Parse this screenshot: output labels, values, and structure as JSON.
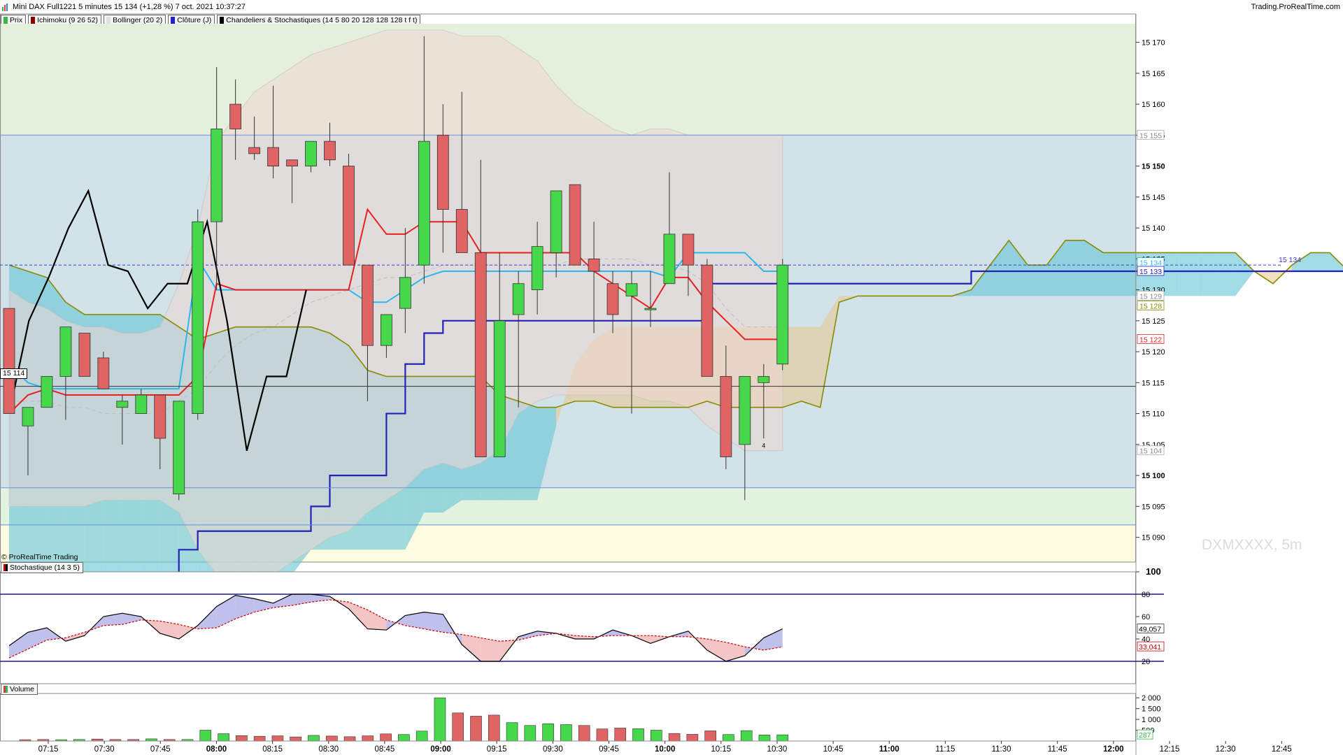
{
  "header": {
    "title": "Mini DAX Full1221 5 minutes 15 134 (+1,28 %) 7 oct. 2021 10:37:27",
    "brand": "Trading.ProRealTime.com"
  },
  "legend": [
    {
      "label": "Prix",
      "color": "#3cb44b"
    },
    {
      "label": "Ichimoku (9 26 52)",
      "color": "#8b0000"
    },
    {
      "label": "Bollinger (20 2)",
      "color": "#e0e0e0"
    },
    {
      "label": "Clôture (J)",
      "color": "#2222cc"
    },
    {
      "label": "Chandeliers & Stochastiques (14 5 80 20 128 128 128 t f t)",
      "color": "#000000"
    }
  ],
  "copyright": "© ProRealTime Trading",
  "watermark": "DXMXXXX, 5m",
  "current_price_left": "15 114",
  "candle_marker": "4",
  "price_labels": [
    {
      "text": "15 134",
      "price": 15134,
      "style": "last"
    },
    {
      "text": "15 134",
      "price": 15134.4,
      "style": "cyan"
    },
    {
      "text": "15 133",
      "price": 15133,
      "style": "navy"
    },
    {
      "text": "15 129",
      "price": 15129,
      "style": "gray"
    },
    {
      "text": "15 128",
      "price": 15127.4,
      "style": "olive"
    },
    {
      "text": "15 122",
      "price": 15122,
      "style": "red"
    },
    {
      "text": "15 155",
      "price": 15155,
      "style": "gray"
    },
    {
      "text": "15 104",
      "price": 15104,
      "style": "gray"
    }
  ],
  "dashed_label": "15 134",
  "stoch_legend": "Stochastique (14 3 5)",
  "stoch_labels": [
    {
      "text": "49,057",
      "value": 49.057,
      "style": "black"
    },
    {
      "text": "33,041",
      "value": 33.041,
      "style": "red"
    }
  ],
  "volume_legend": "Volume",
  "volume_labels": [
    {
      "text": "287",
      "value": 287,
      "style": "green"
    }
  ],
  "chart_data": [
    {
      "type": "candlestick",
      "pane": "price",
      "ylim": [
        15086,
        15173
      ],
      "yticks": [
        15090,
        15095,
        15100,
        15105,
        15110,
        15115,
        15120,
        15125,
        15130,
        15135,
        15140,
        15145,
        15150,
        15155,
        15160,
        15165,
        15170
      ],
      "ytick_labels": [
        "15 090",
        "15 095",
        "15 100",
        "15 105",
        "15 110",
        "15 115",
        "15 120",
        "15 125",
        "15 130",
        "15 135",
        "15 140",
        "15 145",
        "15 150",
        "15 155",
        "15 160",
        "15 165",
        "15 170"
      ],
      "ytick_bold": [
        15100,
        15150
      ],
      "xticks": [
        {
          "label": "07:15",
          "bold": false
        },
        {
          "label": "07:30",
          "bold": false
        },
        {
          "label": "07:45",
          "bold": false
        },
        {
          "label": "08:00",
          "bold": true
        },
        {
          "label": "08:15",
          "bold": false
        },
        {
          "label": "08:30",
          "bold": false
        },
        {
          "label": "08:45",
          "bold": false
        },
        {
          "label": "09:00",
          "bold": true
        },
        {
          "label": "09:15",
          "bold": false
        },
        {
          "label": "09:30",
          "bold": false
        },
        {
          "label": "09:45",
          "bold": false
        },
        {
          "label": "10:00",
          "bold": true
        },
        {
          "label": "10:15",
          "bold": false
        },
        {
          "label": "10:30",
          "bold": false
        },
        {
          "label": "10:45",
          "bold": false
        },
        {
          "label": "11:00",
          "bold": true
        },
        {
          "label": "11:15",
          "bold": false
        },
        {
          "label": "11:30",
          "bold": false
        },
        {
          "label": "11:45",
          "bold": false
        },
        {
          "label": "12:00",
          "bold": true
        },
        {
          "label": "12:15",
          "bold": false
        },
        {
          "label": "12:30",
          "bold": false
        },
        {
          "label": "12:45",
          "bold": false
        }
      ],
      "candles": [
        {
          "o": 15127,
          "h": 15127,
          "l": 15110,
          "c": 15110
        },
        {
          "o": 15108,
          "h": 15111,
          "l": 15100,
          "c": 15111
        },
        {
          "o": 15111,
          "h": 15116,
          "l": 15111,
          "c": 15116
        },
        {
          "o": 15116,
          "h": 15124,
          "l": 15109,
          "c": 15124
        },
        {
          "o": 15123,
          "h": 15123,
          "l": 15116,
          "c": 15116
        },
        {
          "o": 15119,
          "h": 15120,
          "l": 15114,
          "c": 15114
        },
        {
          "o": 15111,
          "h": 15113,
          "l": 15105,
          "c": 15112
        },
        {
          "o": 15110,
          "h": 15114,
          "l": 15110,
          "c": 15113
        },
        {
          "o": 15113,
          "h": 15113,
          "l": 15101,
          "c": 15106
        },
        {
          "o": 15097,
          "h": 15112,
          "l": 15096,
          "c": 15112
        },
        {
          "o": 15110,
          "h": 15143,
          "l": 15109,
          "c": 15141
        },
        {
          "o": 15141,
          "h": 15166,
          "l": 15130,
          "c": 15156
        },
        {
          "o": 15160,
          "h": 15164,
          "l": 15151,
          "c": 15156
        },
        {
          "o": 15153,
          "h": 15158,
          "l": 15151,
          "c": 15152
        },
        {
          "o": 15153,
          "h": 15163,
          "l": 15148,
          "c": 15150
        },
        {
          "o": 15151,
          "h": 15151,
          "l": 15144,
          "c": 15150
        },
        {
          "o": 15150,
          "h": 15154,
          "l": 15149,
          "c": 15154
        },
        {
          "o": 15154,
          "h": 15157,
          "l": 15150,
          "c": 15151
        },
        {
          "o": 15150,
          "h": 15152,
          "l": 15134,
          "c": 15134
        },
        {
          "o": 15134,
          "h": 15134,
          "l": 15112,
          "c": 15121
        },
        {
          "o": 15121,
          "h": 15126,
          "l": 15119,
          "c": 15126
        },
        {
          "o": 15127,
          "h": 15140,
          "l": 15123,
          "c": 15132
        },
        {
          "o": 15134,
          "h": 15171,
          "l": 15131,
          "c": 15154
        },
        {
          "o": 15155,
          "h": 15160,
          "l": 15136,
          "c": 15143
        },
        {
          "o": 15143,
          "h": 15162,
          "l": 15136,
          "c": 15136
        },
        {
          "o": 15136,
          "h": 15151,
          "l": 15103,
          "c": 15103
        },
        {
          "o": 15103,
          "h": 15136,
          "l": 15103,
          "c": 15125
        },
        {
          "o": 15126,
          "h": 15133,
          "l": 15111,
          "c": 15131
        },
        {
          "o": 15130,
          "h": 15141,
          "l": 15126,
          "c": 15137
        },
        {
          "o": 15136,
          "h": 15146,
          "l": 15132,
          "c": 15146
        },
        {
          "o": 15147,
          "h": 15147,
          "l": 15134,
          "c": 15134
        },
        {
          "o": 15135,
          "h": 15141,
          "l": 15123,
          "c": 15133
        },
        {
          "o": 15131,
          "h": 15133,
          "l": 15123,
          "c": 15126
        },
        {
          "o": 15129,
          "h": 15133,
          "l": 15110,
          "c": 15131
        },
        {
          "o": 15127,
          "h": 15133,
          "l": 15124,
          "c": 15127
        },
        {
          "o": 15131,
          "h": 15149,
          "l": 15131,
          "c": 15139
        },
        {
          "o": 15139,
          "h": 15138,
          "l": 15129,
          "c": 15134
        },
        {
          "o": 15134,
          "h": 15135,
          "l": 15116,
          "c": 15116
        },
        {
          "o": 15116,
          "h": 15121,
          "l": 15101,
          "c": 15103
        },
        {
          "o": 15105,
          "h": 15116,
          "l": 15096,
          "c": 15116
        },
        {
          "o": 15115,
          "h": 15118,
          "l": 15106,
          "c": 15116
        },
        {
          "o": 15118,
          "h": 15135,
          "l": 15117,
          "c": 15134
        }
      ],
      "ichimoku": {
        "tenkan": [
          15118,
          15115,
          15114,
          15114,
          15114,
          15114,
          15114,
          15114,
          15114,
          15114,
          15135,
          15130,
          15130,
          15130,
          15130,
          15130,
          15130,
          15130,
          15130,
          15128,
          15128,
          15130,
          15132,
          15133,
          15133,
          15133,
          15133,
          15133,
          15133,
          15133,
          15133,
          15133,
          15133,
          15133,
          15133,
          15132,
          15136,
          15136,
          15136,
          15136,
          15133,
          15133
        ],
        "kijun": [
          15110,
          15113,
          15114,
          15113,
          15113,
          15113,
          15113,
          15113,
          15113,
          15113,
          15116,
          15131,
          15130,
          15130,
          15130,
          15130,
          15130,
          15130,
          15130,
          15143,
          15139,
          15139,
          15141,
          15141,
          15141,
          15136,
          15136,
          15136,
          15136,
          15136,
          15136,
          15133,
          15131,
          15129,
          15127,
          15132,
          15132,
          15128,
          15125,
          15122,
          15122,
          15122
        ],
        "kijun_points": 42,
        "chikou": [
          15110,
          15127,
          15137,
          15146,
          15135,
          15134,
          15127,
          15130,
          15130,
          15127,
          15115,
          15103,
          15116,
          15116,
          15135
        ],
        "span_a": [
          15134,
          15133,
          15132,
          15128,
          15126,
          15126,
          15126,
          15126,
          15126,
          15124,
          15122,
          15123,
          15124,
          15124,
          15124,
          15124,
          15124,
          15123,
          15121,
          15117,
          15116,
          15116,
          15116,
          15116,
          15116,
          15116,
          15113,
          15112,
          15111,
          15111,
          15112,
          15112,
          15111,
          15111,
          15111,
          15111,
          15111,
          15112,
          15111,
          15111,
          15111,
          15111,
          15112,
          15111,
          15128,
          15129,
          15129,
          15129,
          15129,
          15129,
          15129,
          15130,
          15134,
          15138,
          15134,
          15134,
          15138,
          15138,
          15136,
          15136,
          15136,
          15136,
          15136,
          15136,
          15136,
          15136,
          15133,
          15131,
          15134,
          15136,
          15136,
          15133,
          15128,
          15128,
          15128
        ],
        "span_b": [
          15084,
          15084,
          15084,
          15084,
          15084,
          15084,
          15084,
          15084,
          15084,
          15084,
          15084,
          15084,
          15084,
          15084,
          15084,
          15084,
          15088,
          15088,
          15088,
          15088,
          15088,
          15088,
          15094,
          15094,
          15096,
          15096,
          15096,
          15096,
          15096,
          15108,
          15118,
          15122,
          15124,
          15124,
          15124,
          15124,
          15124,
          15124,
          15124,
          15124,
          15124,
          15124,
          15124,
          15124,
          15129,
          15129,
          15129,
          15129,
          15129,
          15129,
          15129,
          15129,
          15129,
          15129,
          15129,
          15129,
          15129,
          15129,
          15129,
          15129,
          15129,
          15129,
          15129,
          15129,
          15129,
          15129,
          15133,
          15133,
          15133,
          15133,
          15133,
          15133,
          15133,
          15133,
          15133
        ]
      },
      "bollinger": {
        "upper": [
          15130,
          15128,
          15127,
          15125,
          15124,
          15124,
          15123,
          15123,
          15124,
          15131,
          15140,
          15154,
          15158,
          15162,
          15164,
          15166,
          15168,
          15169,
          15170,
          15171,
          15172,
          15172,
          15172,
          15172,
          15171,
          15171,
          15171,
          15169,
          15167,
          15163,
          15160,
          15158,
          15156,
          15155,
          15156,
          15156,
          15155,
          15155,
          15155,
          15155,
          15155,
          15155
        ],
        "lower": [
          15095,
          15095,
          15095,
          15095,
          15095,
          15096,
          15096,
          15096,
          15096,
          15094,
          15088,
          15084,
          15084,
          15084,
          15084,
          15086,
          15088,
          15090,
          15091,
          15094,
          15096,
          15098,
          15101,
          15102,
          15101,
          15102,
          15104,
          15110,
          15112,
          15113,
          15113,
          15113,
          15113,
          15113,
          15112,
          15112,
          15111,
          15108,
          15106,
          15104,
          15104,
          15104
        ],
        "middle": [
          15112,
          15112,
          15112,
          15111,
          15111,
          15110,
          15110,
          15110,
          15110,
          15112,
          15114,
          15118,
          15121,
          15123,
          15124,
          15126,
          15128,
          15129,
          15130,
          15131,
          15132,
          15132,
          15133,
          15134,
          15134,
          15134,
          15134,
          15134,
          15134,
          15134,
          15135,
          15135,
          15135,
          15135,
          15134,
          15134,
          15133,
          15131,
          15127,
          15124,
          15124,
          15124
        ]
      },
      "cloture_j": [
        15077,
        15077,
        15077,
        15077,
        15077,
        15077,
        15077,
        15077,
        15077,
        15088,
        15091,
        15091,
        15091,
        15091,
        15091,
        15091,
        15095,
        15100,
        15100,
        15100,
        15110,
        15118,
        15123,
        15125,
        15125,
        15125,
        15125,
        15125,
        15125,
        15125,
        15125,
        15125,
        15125,
        15125,
        15125,
        15125,
        15125,
        15131,
        15131,
        15131,
        15131,
        15131,
        15131,
        15131,
        15131,
        15131,
        15131,
        15131,
        15131,
        15131,
        15131,
        15133,
        15133,
        15133,
        15133,
        15133,
        15133,
        15133,
        15133,
        15133,
        15133,
        15133,
        15133,
        15133,
        15133,
        15133,
        15133,
        15133,
        15133,
        15133,
        15133,
        15133,
        15133,
        15133,
        15133
      ],
      "stoch_candle_line": [
        15110,
        15125,
        15132,
        15140,
        15146,
        15134,
        15133,
        15127,
        15131,
        15131,
        15141,
        15125,
        15104,
        15116,
        15116,
        15130
      ],
      "horizontal_levels": [
        15155,
        15098,
        15092,
        15114.4
      ],
      "last_price": 15134
    },
    {
      "type": "line",
      "pane": "stochastic",
      "ylim": [
        0,
        100
      ],
      "yticks": [
        20,
        40,
        60,
        80,
        100
      ],
      "levels": [
        80,
        20
      ],
      "k": [
        34,
        46,
        50,
        38,
        43,
        60,
        63,
        60,
        45,
        40,
        52,
        69,
        79,
        76,
        72,
        80,
        80,
        78,
        67,
        49,
        48,
        61,
        64,
        62,
        35,
        20,
        20,
        42,
        47,
        45,
        40,
        40,
        48,
        43,
        36,
        42,
        47,
        30,
        20,
        25,
        41,
        49.057
      ],
      "d": [
        23,
        31,
        39,
        41,
        46,
        52,
        53,
        57,
        56,
        53,
        49,
        50,
        58,
        64,
        68,
        70,
        73,
        75,
        73,
        66,
        57,
        52,
        49,
        46,
        44,
        41,
        38,
        39,
        43,
        45,
        43,
        42,
        43,
        43,
        43,
        42,
        42,
        40,
        37,
        33,
        30,
        33.041
      ]
    },
    {
      "type": "bar",
      "pane": "volume",
      "ylim": [
        0,
        2200
      ],
      "yticks": [
        500,
        1000,
        1500,
        2000
      ],
      "ytick_labels": [
        "500",
        "1 000",
        "1 500",
        "2 000"
      ],
      "values": [
        60,
        70,
        60,
        70,
        90,
        70,
        70,
        100,
        70,
        70,
        500,
        340,
        250,
        220,
        240,
        190,
        260,
        230,
        200,
        240,
        330,
        300,
        460,
        2000,
        1300,
        1150,
        1200,
        850,
        720,
        800,
        760,
        720,
        560,
        600,
        570,
        500,
        350,
        310,
        470,
        300,
        480,
        280,
        287
      ],
      "directions": [
        "d",
        "d",
        "u",
        "u",
        "d",
        "d",
        "d",
        "u",
        "d",
        "u",
        "u",
        "u",
        "d",
        "d",
        "d",
        "d",
        "u",
        "d",
        "d",
        "d",
        "d",
        "u",
        "u",
        "u",
        "d",
        "d",
        "d",
        "u",
        "u",
        "u",
        "u",
        "d",
        "d",
        "d",
        "u",
        "u",
        "d",
        "d",
        "d",
        "u",
        "u",
        "u",
        "u"
      ]
    }
  ]
}
